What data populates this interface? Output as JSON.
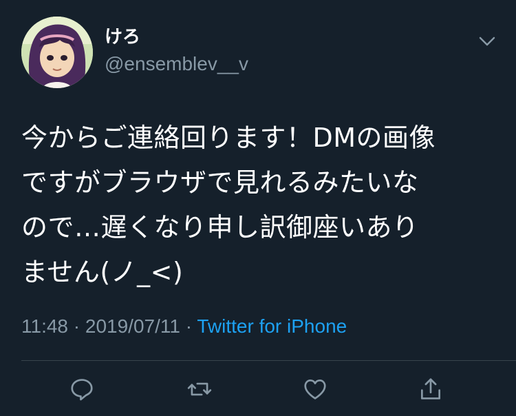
{
  "tweet": {
    "author": {
      "display_name": "けろ",
      "handle": "@ensemblev__v"
    },
    "text_lines": [
      "今からご連絡回ります！DMの画像",
      "ですがブラウザで見れるみたいな",
      "ので…遅くなり申し訳御座いあり",
      "ません(ノ_<)"
    ],
    "time": "11:48",
    "separator": "·",
    "date": "2019/07/11",
    "source": "Twitter for iPhone"
  },
  "actions": {
    "reply_icon": "reply-icon",
    "retweet_icon": "retweet-icon",
    "like_icon": "heart-icon",
    "share_icon": "share-icon"
  },
  "colors": {
    "background": "#15202b",
    "primary_text": "#ffffff",
    "secondary_text": "#8899a6",
    "accent": "#1da1f2",
    "divider": "#38444d"
  }
}
